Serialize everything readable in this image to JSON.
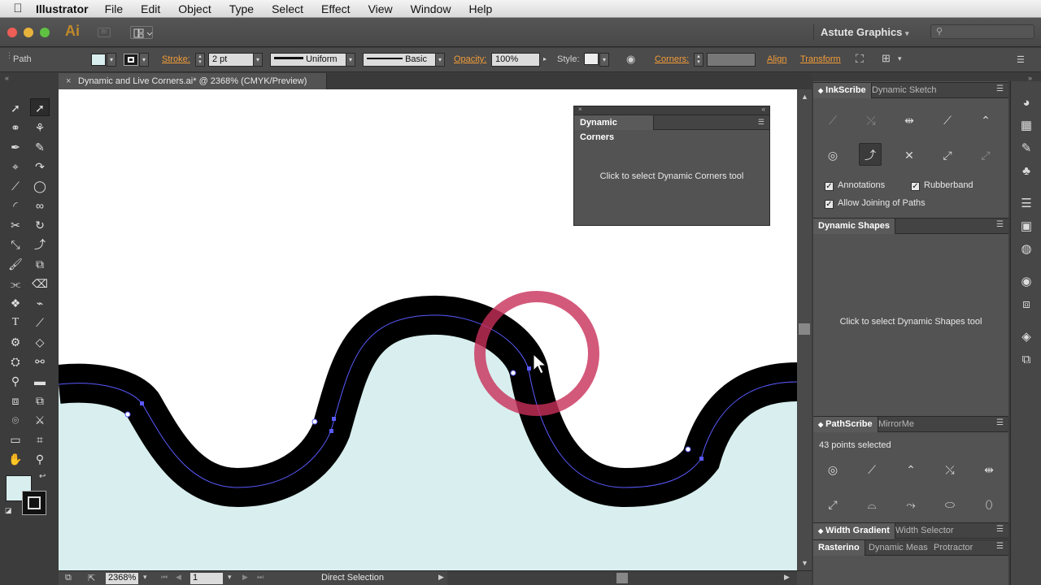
{
  "menubar": {
    "apple": "",
    "app": "Illustrator",
    "items": [
      "File",
      "Edit",
      "Object",
      "Type",
      "Select",
      "Effect",
      "View",
      "Window",
      "Help"
    ]
  },
  "appbar": {
    "logo": "Ai",
    "bridge": "Br",
    "workspace": "Astute Graphics",
    "traffic_colors": [
      "#ec5e56",
      "#e8b33b",
      "#5fc141"
    ]
  },
  "control": {
    "selection_type": "Path",
    "stroke_label": "Stroke:",
    "stroke_weight": "2 pt",
    "profile": "Uniform",
    "brush": "Basic",
    "opacity_label": "Opacity:",
    "opacity": "100%",
    "style_label": "Style:",
    "corners_label": "Corners:",
    "align_label": "Align",
    "transform_label": "Transform"
  },
  "document": {
    "tab_title": "Dynamic and Live Corners.ai* @ 2368% (CMYK/Preview)"
  },
  "canvas": {
    "fill_color": "#d9efef",
    "stroke_color": "#000000",
    "path_color": "#5a5aff",
    "cursor_ring_color": "#c8305a"
  },
  "dynamic_corners_panel": {
    "title": "Dynamic Corners",
    "message": "Click to select Dynamic Corners tool"
  },
  "right_panels": {
    "inkscribe": {
      "tabs": [
        "InkScribe",
        "Dynamic Sketch"
      ],
      "annotations": "Annotations",
      "rubberband": "Rubberband",
      "allow_joining": "Allow Joining of Paths"
    },
    "dynamic_shapes": {
      "title": "Dynamic Shapes",
      "message": "Click to select Dynamic Shapes tool"
    },
    "pathscribe": {
      "tabs": [
        "PathScribe",
        "MirrorMe"
      ],
      "status": "43 points selected"
    },
    "width_tabs": [
      "Width Gradient",
      "Width Selector"
    ],
    "bottom_tabs": [
      "Rasterino",
      "Dynamic Meas",
      "Protractor"
    ]
  },
  "status": {
    "zoom": "2368%",
    "artboard": "1",
    "tool": "Direct Selection"
  }
}
